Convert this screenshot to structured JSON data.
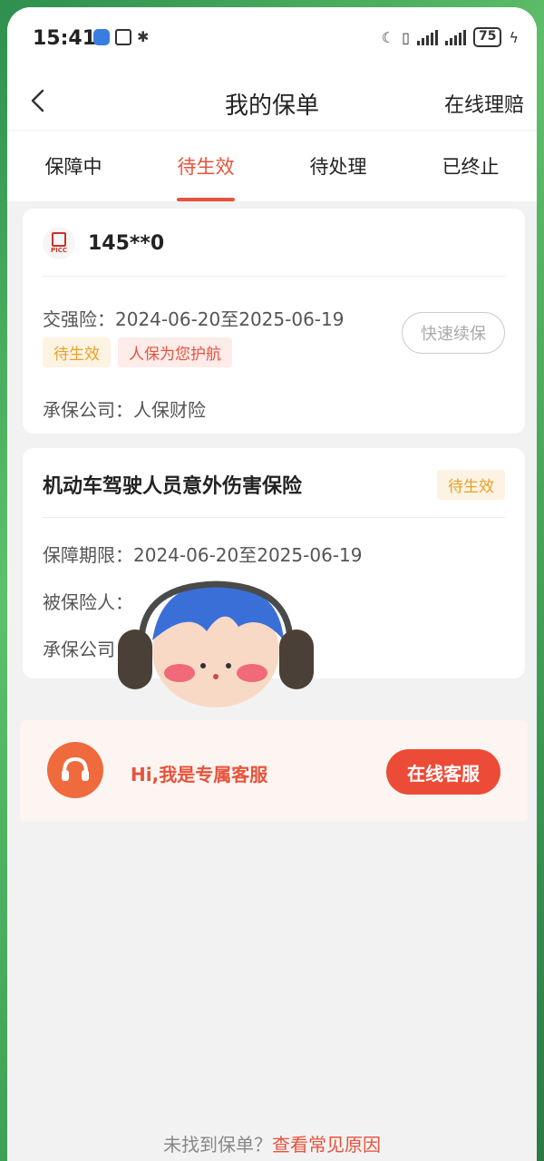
{
  "status_bar": {
    "time": "15:41",
    "battery": "75"
  },
  "header": {
    "title": "我的保单",
    "right_action": "在线理赔"
  },
  "tabs": [
    {
      "label": "保障中",
      "active": false
    },
    {
      "label": "待生效",
      "active": true
    },
    {
      "label": "待处理",
      "active": false
    },
    {
      "label": "已终止",
      "active": false
    }
  ],
  "policies": [
    {
      "logo_text": "PICC",
      "plate": "145**0",
      "coverage": "交强险：2024-06-20至2025-06-19",
      "tags": [
        "待生效",
        "人保为您护航"
      ],
      "renew_button": "快速续保",
      "insurer": "承保公司：人保财险"
    },
    {
      "title": "机动车驾驶人员意外伤害保险",
      "status": "待生效",
      "period": "保障期限：2024-06-20至2025-06-19",
      "insured_label": "被保险人：",
      "insurer_label": "承保公司"
    }
  ],
  "service": {
    "text": "Hi,我是专属客服",
    "button": "在线客服"
  },
  "footer": {
    "text": "未找到保单？",
    "link": "查看常见原因"
  },
  "colors": {
    "accent": "#e8523c",
    "tag_yellow": "#e8a12a",
    "service_button": "#ec4b37"
  }
}
